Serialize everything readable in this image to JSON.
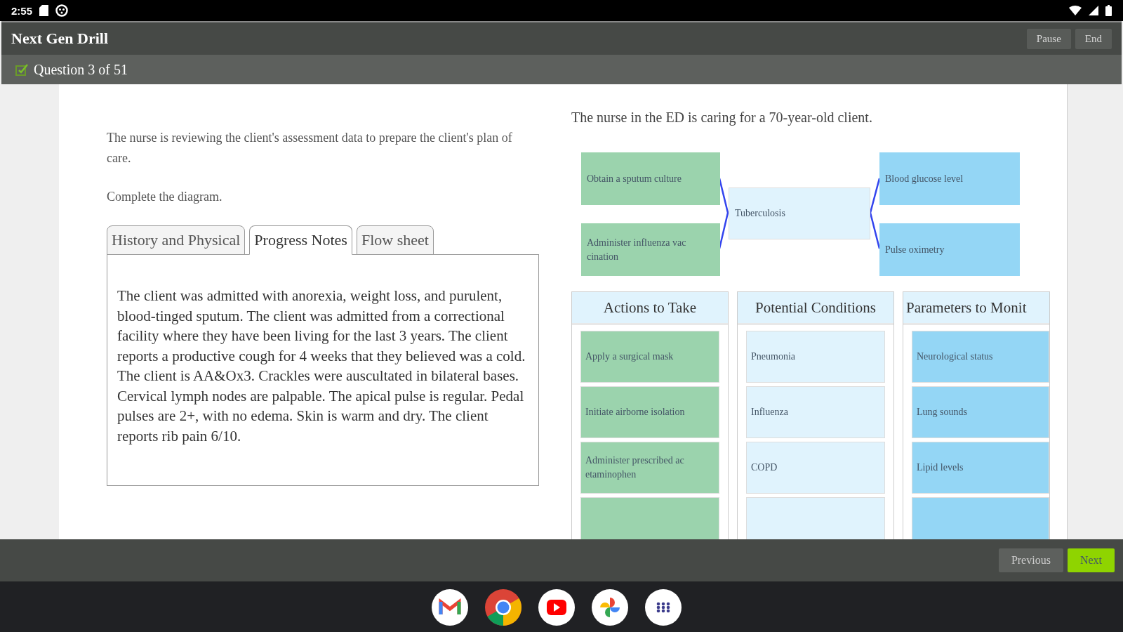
{
  "status_bar": {
    "time": "2:55"
  },
  "app_bar": {
    "title": "Next Gen Drill",
    "buttons": [
      "Pause",
      "End"
    ]
  },
  "question_bar": {
    "label": "Question 3 of 51"
  },
  "instructions": [
    "The nurse is reviewing the client's assessment data to prepare the client's plan of care.",
    "Complete the diagram."
  ],
  "tabs": [
    {
      "label": "History and Physical",
      "selected": false
    },
    {
      "label": "Progress Notes",
      "selected": true
    },
    {
      "label": "Flow sheet",
      "selected": false
    }
  ],
  "tab_content": "The client was admitted with anorexia, weight loss, and purulent, blood-tinged sputum. The client was admitted from a correctional facility where they have been living for the last 3 years. The client reports a productive cough for 4 weeks that they believed was a cold. The client is AA&Ox3. Crackles were auscultated in bilateral bases. Cervical lymph nodes are palpable. The apical pulse is regular. Pedal pulses are 2+, with no edema. Skin is warm and dry. The client reports rib pain 6/10.",
  "scenario": "The nurse in the ED is caring for a 70-year-old client.",
  "diagram": {
    "actions": [
      "Obtain a sputum culture",
      "Administer influenza vac cination"
    ],
    "condition": "Tuberculosis",
    "parameters": [
      "Blood glucose level",
      "Pulse oximetry"
    ]
  },
  "option_columns": [
    {
      "kind": "action",
      "header": "Actions to Take",
      "items": [
        "Apply a surgical mask",
        "Initiate airborne isolation",
        "Administer prescribed ac etaminophen"
      ]
    },
    {
      "kind": "condition",
      "header": "Potential Conditions",
      "items": [
        "Pneumonia",
        "Influenza",
        "COPD"
      ]
    },
    {
      "kind": "parameter",
      "header": "Parameters to Monit",
      "items": [
        "Neurological status",
        "Lung sounds",
        "Lipid levels"
      ]
    }
  ],
  "footer": {
    "buttons": [
      {
        "label": "Previous",
        "kind": "secondary"
      },
      {
        "label": "Next",
        "kind": "primary"
      }
    ]
  }
}
